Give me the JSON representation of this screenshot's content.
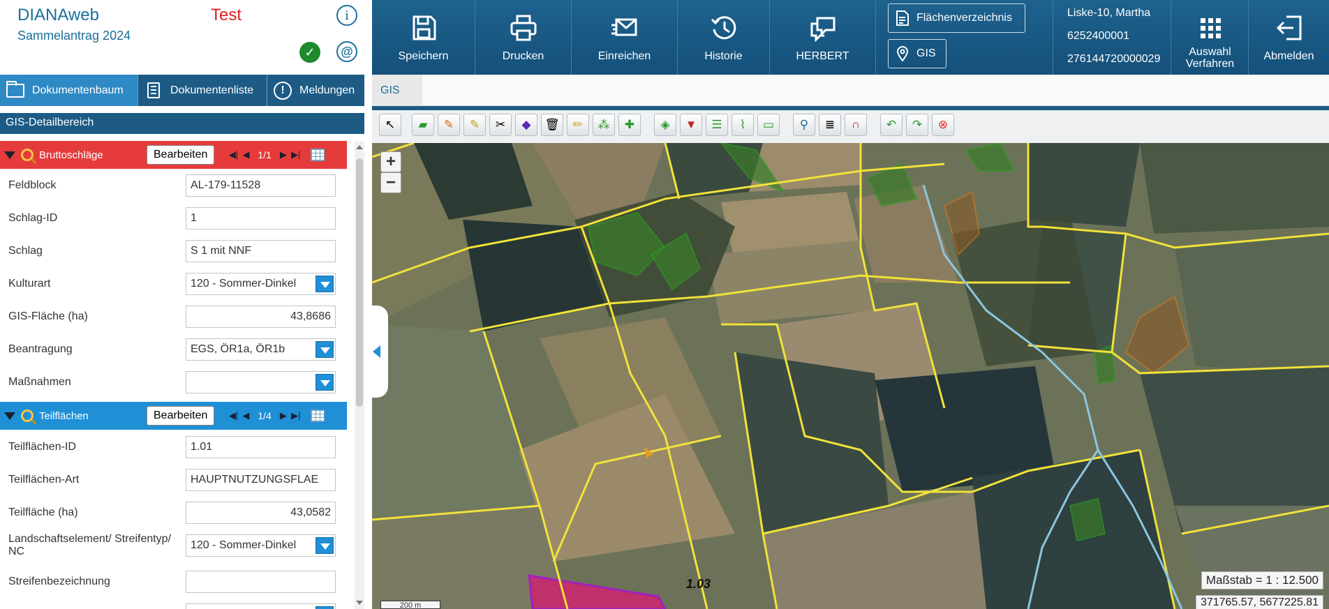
{
  "app": {
    "title": "DIANAweb",
    "subtitle": "Sammelantrag 2024",
    "environment": "Test"
  },
  "left_tabs": [
    {
      "label": "Dokumentenbaum",
      "icon": "folder-icon",
      "active": true
    },
    {
      "label": "Dokumentenliste",
      "icon": "document-list-icon",
      "active": false
    },
    {
      "label": "Meldungen",
      "icon": "warning-icon",
      "active": false
    }
  ],
  "detail_header": "GIS-Detailbereich",
  "sections": {
    "brutto": {
      "title": "Bruttoschläge",
      "edit_label": "Bearbeiten",
      "page": "1/1",
      "color": "#e63b3b",
      "fields": [
        {
          "label": "Feldblock",
          "value": "AL-179-11528",
          "type": "text"
        },
        {
          "label": "Schlag-ID",
          "value": "1",
          "type": "text"
        },
        {
          "label": "Schlag",
          "value": "S 1 mit NNF",
          "type": "text"
        },
        {
          "label": "Kulturart",
          "value": "120 - Sommer-Dinkel",
          "type": "select"
        },
        {
          "label": "GIS-Fläche (ha)",
          "value": "43,8686",
          "type": "number"
        },
        {
          "label": "Beantragung",
          "value": "EGS, ÖR1a, ÖR1b",
          "type": "select"
        },
        {
          "label": "Maßnahmen",
          "value": "",
          "type": "select"
        }
      ]
    },
    "teil": {
      "title": "Teilflächen",
      "edit_label": "Bearbeiten",
      "page": "1/4",
      "color": "#1f8fd6",
      "fields": [
        {
          "label": "Teilflächen-ID",
          "value": "1.01",
          "type": "text"
        },
        {
          "label": "Teilflächen-Art",
          "value": "HAUPTNUTZUNGSFLAE",
          "type": "text"
        },
        {
          "label": "Teilfläche (ha)",
          "value": "43,0582",
          "type": "number"
        },
        {
          "label": "Landschaftselement/ Streifentyp/ NC",
          "value": "120 - Sommer-Dinkel",
          "type": "select"
        },
        {
          "label": "Streifenbezeichnung",
          "value": "",
          "type": "text"
        }
      ]
    }
  },
  "toolbar": {
    "save": "Speichern",
    "print": "Drucken",
    "submit": "Einreichen",
    "history": "Historie",
    "herbert": "HERBERT",
    "field_index": "Flächenverzeichnis",
    "gis": "GIS",
    "select_procedure": "Auswahl Verfahren",
    "logout": "Abmelden"
  },
  "user": {
    "name": "Liske-10, Martha",
    "number1": "6252400001",
    "number2": "276144720000029"
  },
  "gis_tab": "GIS",
  "map": {
    "zoom_in": "+",
    "zoom_out": "−",
    "scale": "Maßstab = 1 : 12.500",
    "coordinates": "371765.57, 5677225.81",
    "scalebar": "200 m",
    "parcel_label": "1.03"
  },
  "map_tools": [
    "select-arrow-icon",
    "add-polygon-icon",
    "edit-polygon-icon",
    "edit-vertex-icon",
    "cut-polygon-icon",
    "merge-polygon-icon",
    "delete-icon",
    "pencil-icon",
    "node-tool-icon",
    "move-tool-icon",
    "layer-add-icon",
    "layer-down-icon",
    "layer-stack-icon",
    "measure-line-icon",
    "measure-area-icon",
    "parcel-info-icon",
    "list-icon",
    "magnet-icon",
    "undo-icon",
    "redo-icon",
    "cancel-icon"
  ]
}
